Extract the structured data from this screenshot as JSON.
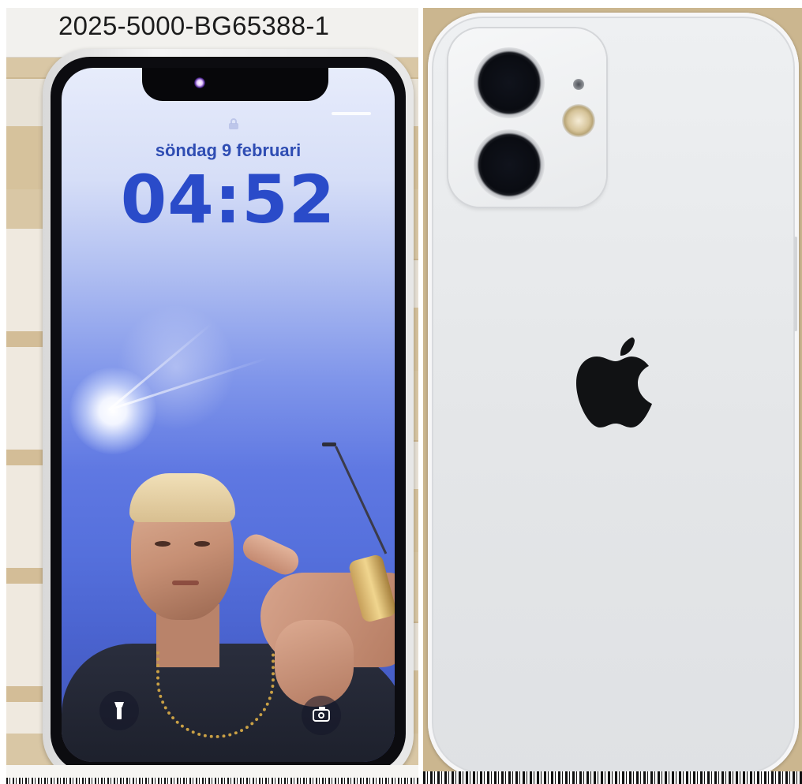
{
  "evidence_label": {
    "text": "2025-5000-BG65388-1"
  },
  "lock_screen": {
    "date": "söndag 9 februari",
    "time": "04:52"
  },
  "icons": {
    "lock": "lock-icon",
    "flashlight": "flashlight-icon",
    "camera": "camera-icon",
    "apple": "apple-logo-icon"
  },
  "colors": {
    "clock_blue": "#2a4bc9",
    "phone_body_white": "#e8eaec"
  }
}
